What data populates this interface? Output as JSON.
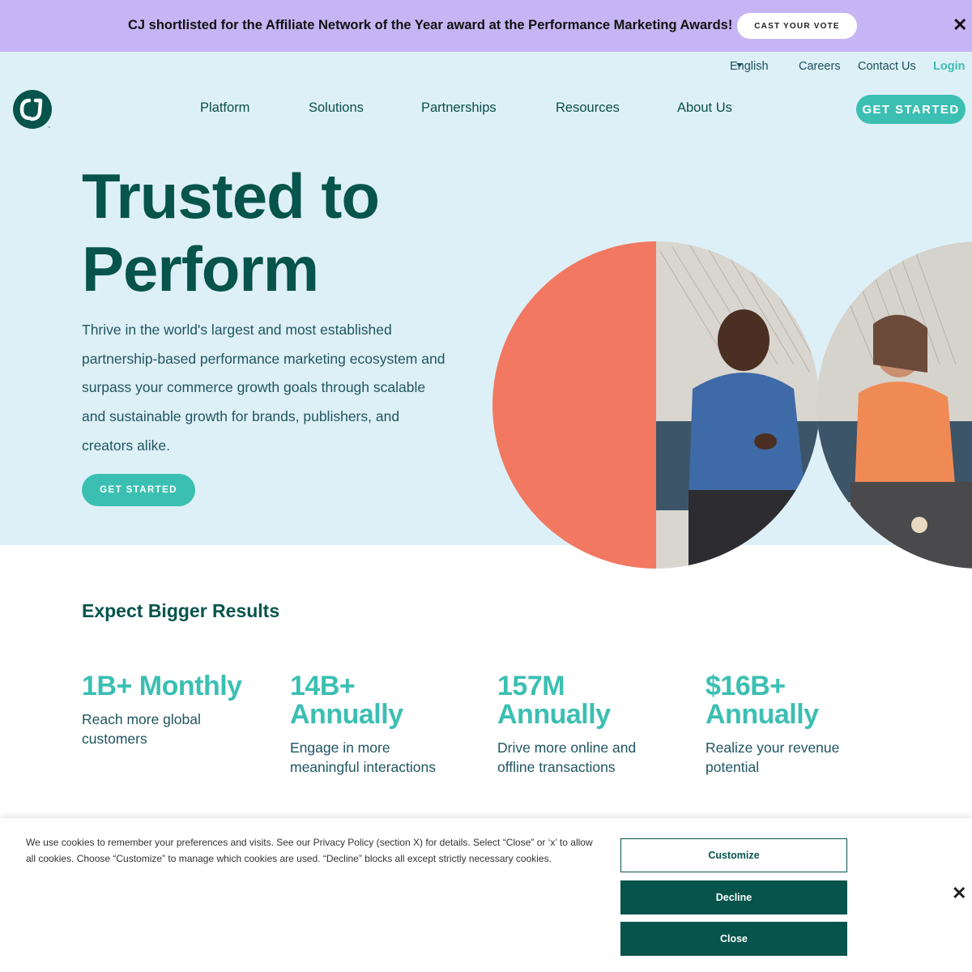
{
  "announcement": {
    "text": "CJ shortlisted for the Affiliate Network of the Year award at the Performance Marketing Awards!",
    "button_label": "CAST YOUR VOTE",
    "close_glyph": "✕",
    "background_color": "#c6b5f4"
  },
  "utility_nav": {
    "language": "English",
    "careers": "Careers",
    "contact": "Contact Us",
    "login": "Login"
  },
  "logo": {
    "icon": "cj-logo-icon",
    "color": "#06544c"
  },
  "main_nav": {
    "items": [
      "Platform",
      "Solutions",
      "Partnerships",
      "Resources",
      "About Us"
    ],
    "cta": "GET STARTED"
  },
  "hero": {
    "title_line1": "Trusted to",
    "title_line2": "Perform",
    "description": "Thrive in the world's largest and most established partnership-based performance marketing ecosystem and surpass your commerce growth goals through scalable and sustainable growth for brands, publishers, and creators alike.",
    "cta": "GET STARTED",
    "background_color": "#def0f7",
    "accent_color": "#f27861"
  },
  "results": {
    "title": "Expect Bigger Results",
    "stats": [
      {
        "value": "1B+ Monthly",
        "desc": "Reach more global customers"
      },
      {
        "value": "14B+ Annually",
        "desc": "Engage in more meaningful interactions"
      },
      {
        "value": "157M Annually",
        "desc": "Drive more online and offline transactions"
      },
      {
        "value": "$16B+ Annually",
        "desc": "Realize your revenue potential"
      }
    ]
  },
  "cookie_banner": {
    "text": "We use cookies to remember your preferences and visits. See our Privacy Policy (section X) for details. Select “Close” or ‘x’ to allow all cookies. Choose “Customize” to manage which cookies are used. “Decline” blocks all except strictly necessary cookies.",
    "customize": "Customize",
    "decline": "Decline",
    "close": "Close",
    "close_glyph": "✕"
  },
  "colors": {
    "brand_dark": "#06544c",
    "brand_teal": "#3bbfb2",
    "coral": "#f27861"
  }
}
